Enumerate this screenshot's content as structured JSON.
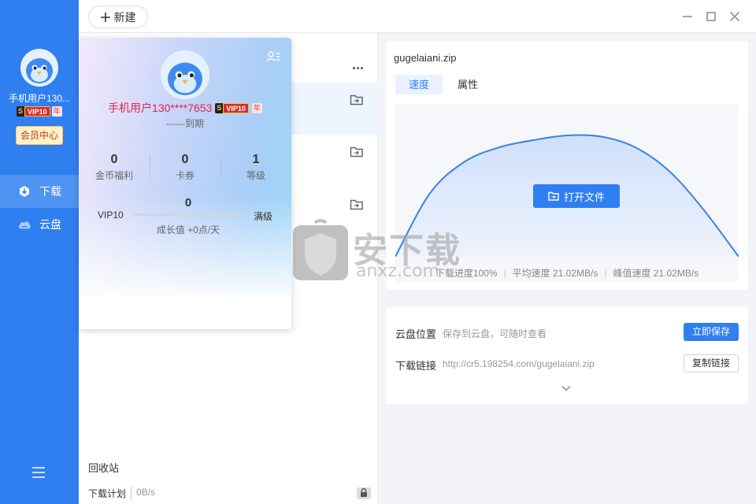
{
  "sidebar": {
    "username": "手机用户130...",
    "vip_badge": "VIP10",
    "year_badge": "年",
    "member_center": "会员中心",
    "nav": [
      {
        "label": "下载",
        "icon": "download-icon",
        "active": true
      },
      {
        "label": "云盘",
        "icon": "cloud-icon",
        "active": false
      }
    ],
    "menu_icon": "hamburger-menu-icon"
  },
  "toolbar": {
    "new_label": "新建"
  },
  "user_card": {
    "name": "手机用户130****7653",
    "vip_badge": "VIP10",
    "year_badge": "年",
    "expire": "------到期",
    "stats": [
      {
        "value": "0",
        "label": "金币福利"
      },
      {
        "value": "0",
        "label": "卡券"
      },
      {
        "value": "1",
        "label": "等级"
      }
    ],
    "growth_value": "0",
    "level_left": "VIP10",
    "level_right": "满级",
    "level_progress": 0,
    "growth_text": "成长值 +0点/天"
  },
  "list": {
    "recycle": "回收站",
    "plan_label": "下载计划",
    "plan_speed": "0B/s"
  },
  "detail": {
    "filename": "gugelaiani.zip",
    "tabs": [
      {
        "label": "速度",
        "active": true
      },
      {
        "label": "属性",
        "active": false
      }
    ],
    "open_button": "打开文件",
    "progress_text": "下载进度100%",
    "avg_speed": "平均速度 21.02MB/s",
    "peak_speed": "峰值速度 21.02MB/s"
  },
  "chart_data": {
    "type": "area",
    "x": [
      0,
      1,
      2,
      3,
      4,
      5,
      6,
      7,
      8,
      9,
      10
    ],
    "values": [
      0,
      0.52,
      0.78,
      0.9,
      0.96,
      1.0,
      0.99,
      0.9,
      0.7,
      0.38,
      0
    ],
    "ylim": [
      0,
      1
    ],
    "grid": false,
    "line_color": "#3b82e0",
    "fill_color": "#cfe0fb"
  },
  "cloud": {
    "location_label": "云盘位置",
    "location_value": "保存到云盘，可随时查看",
    "save_button": "立即保存",
    "link_label": "下载链接",
    "link_value": "http://cr5.198254.com/gugelaiani.zip",
    "copy_button": "复制链接"
  },
  "watermark": {
    "text_cn": "安下载",
    "text_en": "anxz.com"
  },
  "colors": {
    "accent": "#2f7ff0",
    "vip_name": "#e0264a"
  }
}
